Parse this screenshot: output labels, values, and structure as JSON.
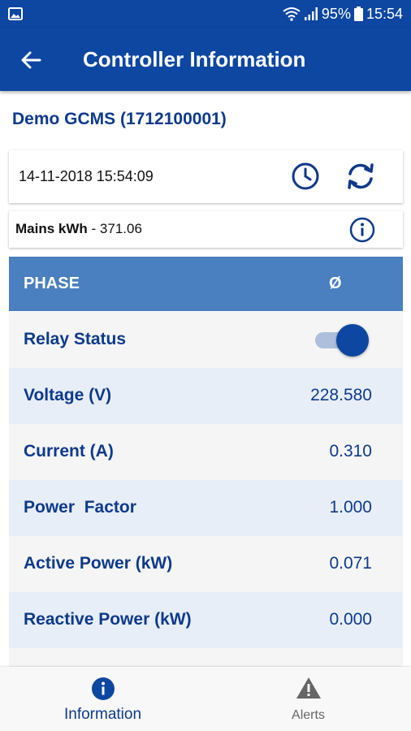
{
  "status_bar": {
    "battery": "95%",
    "time": "15:54",
    "icons": [
      "gallery-icon",
      "wifi-icon",
      "signal-icon",
      "battery-icon"
    ]
  },
  "app_bar": {
    "title": "Controller Information",
    "back_icon": "arrow-left-icon"
  },
  "device": {
    "name": "Demo GCMS (1712100001)"
  },
  "datetime": {
    "value": "14-11-2018 15:54:09",
    "icons": [
      "clock-icon",
      "refresh-icon"
    ]
  },
  "mains": {
    "label": "Mains kWh",
    "separator": " - ",
    "value": "371.06",
    "icon": "info-icon"
  },
  "table": {
    "header": {
      "label": "PHASE",
      "symbol": "Ø"
    },
    "relay_status": {
      "label": "Relay Status",
      "on": true
    },
    "rows": [
      {
        "label": "Voltage (V)",
        "value": "228.580"
      },
      {
        "label": "Current (A)",
        "value": "0.310"
      },
      {
        "label": "Power  Factor",
        "value": "1.000"
      },
      {
        "label": "Active Power (kW)",
        "value": "0.071"
      },
      {
        "label": "Reactive Power (kW)",
        "value": "0.000"
      }
    ]
  },
  "bottom_nav": {
    "items": [
      {
        "label": "Information",
        "icon": "info-filled-icon",
        "active": true
      },
      {
        "label": "Alerts",
        "icon": "warning-icon",
        "active": false
      }
    ]
  },
  "colors": {
    "primary": "#0d47a1",
    "header_blue": "#4a7fc0",
    "text_blue": "#0d3a8c",
    "row_alt": "#e8eef7"
  }
}
